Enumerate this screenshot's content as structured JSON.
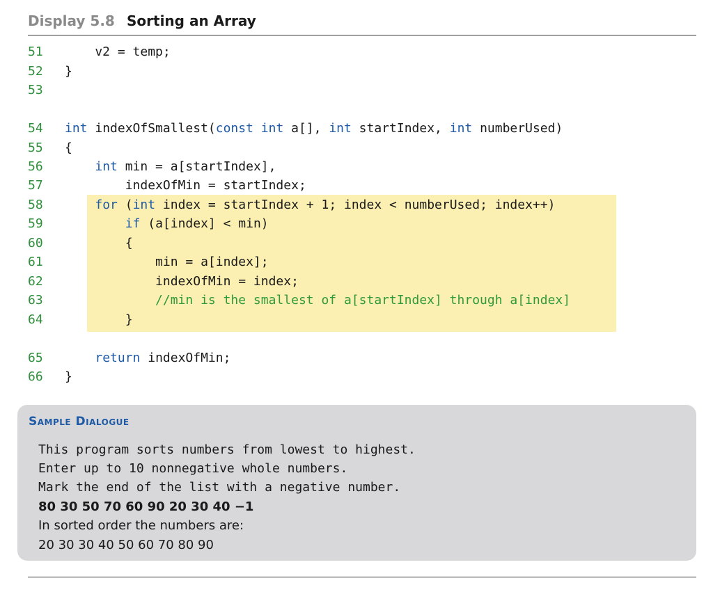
{
  "header": {
    "label": "Display 5.8",
    "title": "Sorting an Array"
  },
  "code_lines": [
    {
      "num": "51",
      "tokens": [
        {
          "t": "    v2 = temp;",
          "c": "p"
        }
      ]
    },
    {
      "num": "52",
      "tokens": [
        {
          "t": "}",
          "c": "p"
        }
      ]
    },
    {
      "num": "53",
      "tokens": []
    },
    {
      "num": "54",
      "tokens": [
        {
          "t": "int",
          "c": "k"
        },
        {
          "t": " indexOfSmallest(",
          "c": "p"
        },
        {
          "t": "const",
          "c": "k"
        },
        {
          "t": " ",
          "c": "p"
        },
        {
          "t": "int",
          "c": "k"
        },
        {
          "t": " a[], ",
          "c": "p"
        },
        {
          "t": "int",
          "c": "k"
        },
        {
          "t": " startIndex, ",
          "c": "p"
        },
        {
          "t": "int",
          "c": "k"
        },
        {
          "t": " numberUsed)",
          "c": "p"
        }
      ]
    },
    {
      "num": "55",
      "tokens": [
        {
          "t": "{",
          "c": "p"
        }
      ]
    },
    {
      "num": "56",
      "tokens": [
        {
          "t": "    ",
          "c": "p"
        },
        {
          "t": "int",
          "c": "k"
        },
        {
          "t": " min = a[startIndex],",
          "c": "p"
        }
      ]
    },
    {
      "num": "57",
      "tokens": [
        {
          "t": "        indexOfMin = startIndex;",
          "c": "p"
        }
      ]
    },
    {
      "num": "58",
      "tokens": [
        {
          "t": "    ",
          "c": "p"
        },
        {
          "t": "for",
          "c": "k"
        },
        {
          "t": " (",
          "c": "p"
        },
        {
          "t": "int",
          "c": "k"
        },
        {
          "t": " index = startIndex + 1; index < numberUsed; index++)",
          "c": "p"
        }
      ]
    },
    {
      "num": "59",
      "tokens": [
        {
          "t": "        ",
          "c": "p"
        },
        {
          "t": "if",
          "c": "k"
        },
        {
          "t": " (a[index] < min)",
          "c": "p"
        }
      ]
    },
    {
      "num": "60",
      "tokens": [
        {
          "t": "        {",
          "c": "p"
        }
      ]
    },
    {
      "num": "61",
      "tokens": [
        {
          "t": "            min = a[index];",
          "c": "p"
        }
      ]
    },
    {
      "num": "62",
      "tokens": [
        {
          "t": "            indexOfMin = index;",
          "c": "p"
        }
      ]
    },
    {
      "num": "63",
      "tokens": [
        {
          "t": "            ",
          "c": "p"
        },
        {
          "t": "//min is the smallest of a[startIndex] through a[index]",
          "c": "c"
        }
      ]
    },
    {
      "num": "64",
      "tokens": [
        {
          "t": "        }",
          "c": "p"
        }
      ]
    },
    {
      "num": "65",
      "tokens": [
        {
          "t": "    ",
          "c": "p"
        },
        {
          "t": "return",
          "c": "k"
        },
        {
          "t": " indexOfMin;",
          "c": "p"
        }
      ]
    },
    {
      "num": "66",
      "tokens": [
        {
          "t": "}",
          "c": "p"
        }
      ]
    }
  ],
  "dialogue": {
    "title": "Sample Dialogue",
    "lines": [
      {
        "text": "This program sorts numbers from lowest to highest.",
        "style": "mono"
      },
      {
        "text": "Enter up to 10 nonnegative whole numbers.",
        "style": "mono"
      },
      {
        "text": "Mark the end of the list with a negative number.",
        "style": "mono"
      },
      {
        "text": "80 30 50 70 60 90 20 30 40 −1",
        "style": "bold"
      },
      {
        "text": "In sorted order the numbers are:",
        "style": "sans"
      },
      {
        "text": "20 30 30 40 50 60 70 80 90",
        "style": "sans"
      }
    ]
  },
  "colors": {
    "keyword": "#1f5aa6",
    "comment": "#2f9a3c",
    "line_number": "#2f8f3c",
    "highlight": "#fbefb1",
    "dialogue_bg": "#d8d8da"
  }
}
